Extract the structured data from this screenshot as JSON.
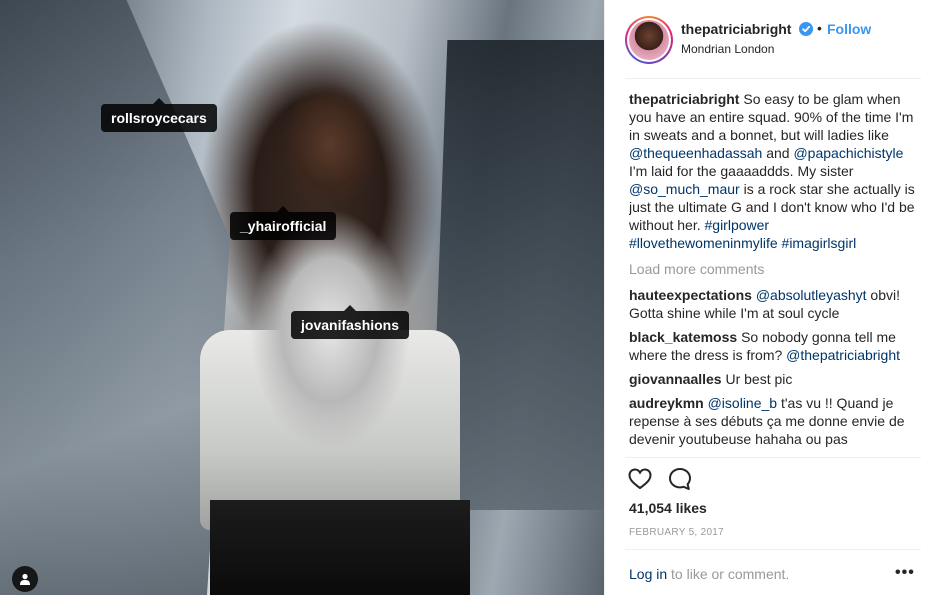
{
  "photo": {
    "tags": [
      {
        "label": "rollsroycecars"
      },
      {
        "label": "_yhairofficial"
      },
      {
        "label": "jovanifashions"
      }
    ],
    "user_tag_icon": "user-icon"
  },
  "post": {
    "username": "thepatriciabright",
    "verified_icon": "verified-badge-icon",
    "separator": "•",
    "follow_label": "Follow",
    "location": "Mondrian London",
    "caption": {
      "author": "thepatriciabright",
      "text_1": " So easy to be glam when you have an entire squad. 90% of the time I'm in sweats and a bonnet, but will ladies like ",
      "mention_1": "@thequeenhadassah",
      "text_2": " and ",
      "mention_2": "@papachichistyle",
      "text_3": " I'm laid for the gaaaaddds. My sister ",
      "mention_3": "@so_much_maur",
      "text_4": " is a rock star she actually is just the ultimate G and I don't know who I'd be without her. ",
      "hashtag_1": "#girlpower",
      "hashtag_2": "#llovethewomeninmylife",
      "hashtag_3": "#imagirlsgirl"
    },
    "load_more": "Load more comments",
    "comments": [
      {
        "author": "hauteexpectations",
        "mention": "@absolutleyashyt",
        "text": " obvi! Gotta shine while I'm at soul cycle"
      },
      {
        "author": "black_katemoss",
        "text": " So nobody gonna tell me where the dress is from? ",
        "mention": "@thepatriciabright"
      },
      {
        "author": "giovannaalles",
        "text": " Ur best pic"
      },
      {
        "author": "audreykmn",
        "mention": "@isoline_b",
        "text": " t'as vu !! Quand je repense à ses débuts ça me donne envie de devenir youtubeuse hahaha ou pas"
      }
    ],
    "like_icon": "heart-icon",
    "comment_icon": "comment-icon",
    "likes": "41,054 likes",
    "date": "FEBRUARY 5, 2017",
    "login_link": "Log in",
    "login_text": " to like or comment.",
    "more_icon": "more-options-icon",
    "more_label": "•••"
  }
}
